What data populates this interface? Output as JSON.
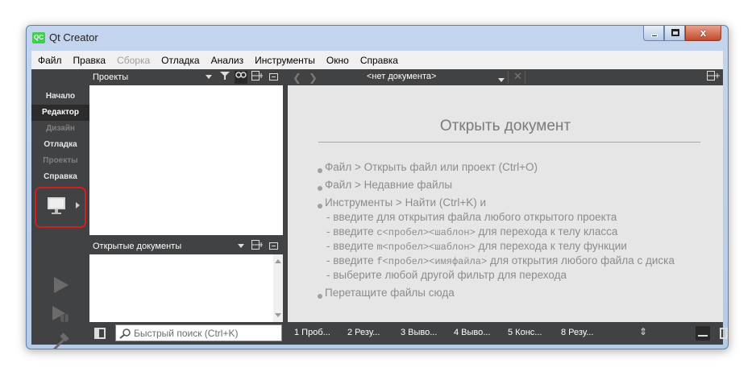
{
  "window": {
    "title": "Qt Creator",
    "app_icon_text": "QC",
    "close_glyph": "x"
  },
  "menubar": [
    {
      "label": "Файл",
      "enabled": true
    },
    {
      "label": "Правка",
      "enabled": true
    },
    {
      "label": "Сборка",
      "enabled": false
    },
    {
      "label": "Отладка",
      "enabled": true
    },
    {
      "label": "Анализ",
      "enabled": true
    },
    {
      "label": "Инструменты",
      "enabled": true
    },
    {
      "label": "Окно",
      "enabled": true
    },
    {
      "label": "Справка",
      "enabled": true
    }
  ],
  "modes": [
    {
      "label": "Начало",
      "state": "normal"
    },
    {
      "label": "Редактор",
      "state": "active"
    },
    {
      "label": "Дизайн",
      "state": "disabled"
    },
    {
      "label": "Отладка",
      "state": "normal"
    },
    {
      "label": "Проекты",
      "state": "disabled"
    },
    {
      "label": "Справка",
      "state": "normal"
    }
  ],
  "projects_pane": {
    "title": "Проекты"
  },
  "open_docs_pane": {
    "title": "Открытые документы"
  },
  "editor": {
    "document_title": "<нет документа>",
    "welcome": {
      "title": "Открыть документ",
      "items": [
        {
          "text": "Файл > Открыть файл или проект (Ctrl+O)"
        },
        {
          "text": "Файл > Недавние файлы"
        },
        {
          "text": "Инструменты > Найти (Ctrl+K) и",
          "sub": [
            {
              "pre": "- введите для открытия файла любого открытого проекта",
              "code": "",
              "post": ""
            },
            {
              "pre": "- введите ",
              "code": "c<пробел><шаблон>",
              "post": " для перехода к телу класса"
            },
            {
              "pre": "- введите ",
              "code": "m<пробел><шаблон>",
              "post": " для перехода к телу функции"
            },
            {
              "pre": "- введите ",
              "code": "f<пробел><имяфайла>",
              "post": " для открытия любого файла с диска"
            },
            {
              "pre": "- выберите любой другой фильтр для перехода",
              "code": "",
              "post": ""
            }
          ]
        },
        {
          "text": "Перетащите файлы сюда"
        }
      ]
    }
  },
  "statusbar": {
    "locator_placeholder": "Быстрый поиск (Ctrl+K)",
    "output_tabs": [
      "1 Проб...",
      "2 Резу...",
      "3 Выво...",
      "4 Выво...",
      "5 Конс...",
      "8 Резу..."
    ]
  },
  "colors": {
    "panel_bg": "#404244",
    "editor_bg": "#e6e6e6",
    "highlight_border": "#d02020",
    "title_bar": "#c3d5ee"
  }
}
